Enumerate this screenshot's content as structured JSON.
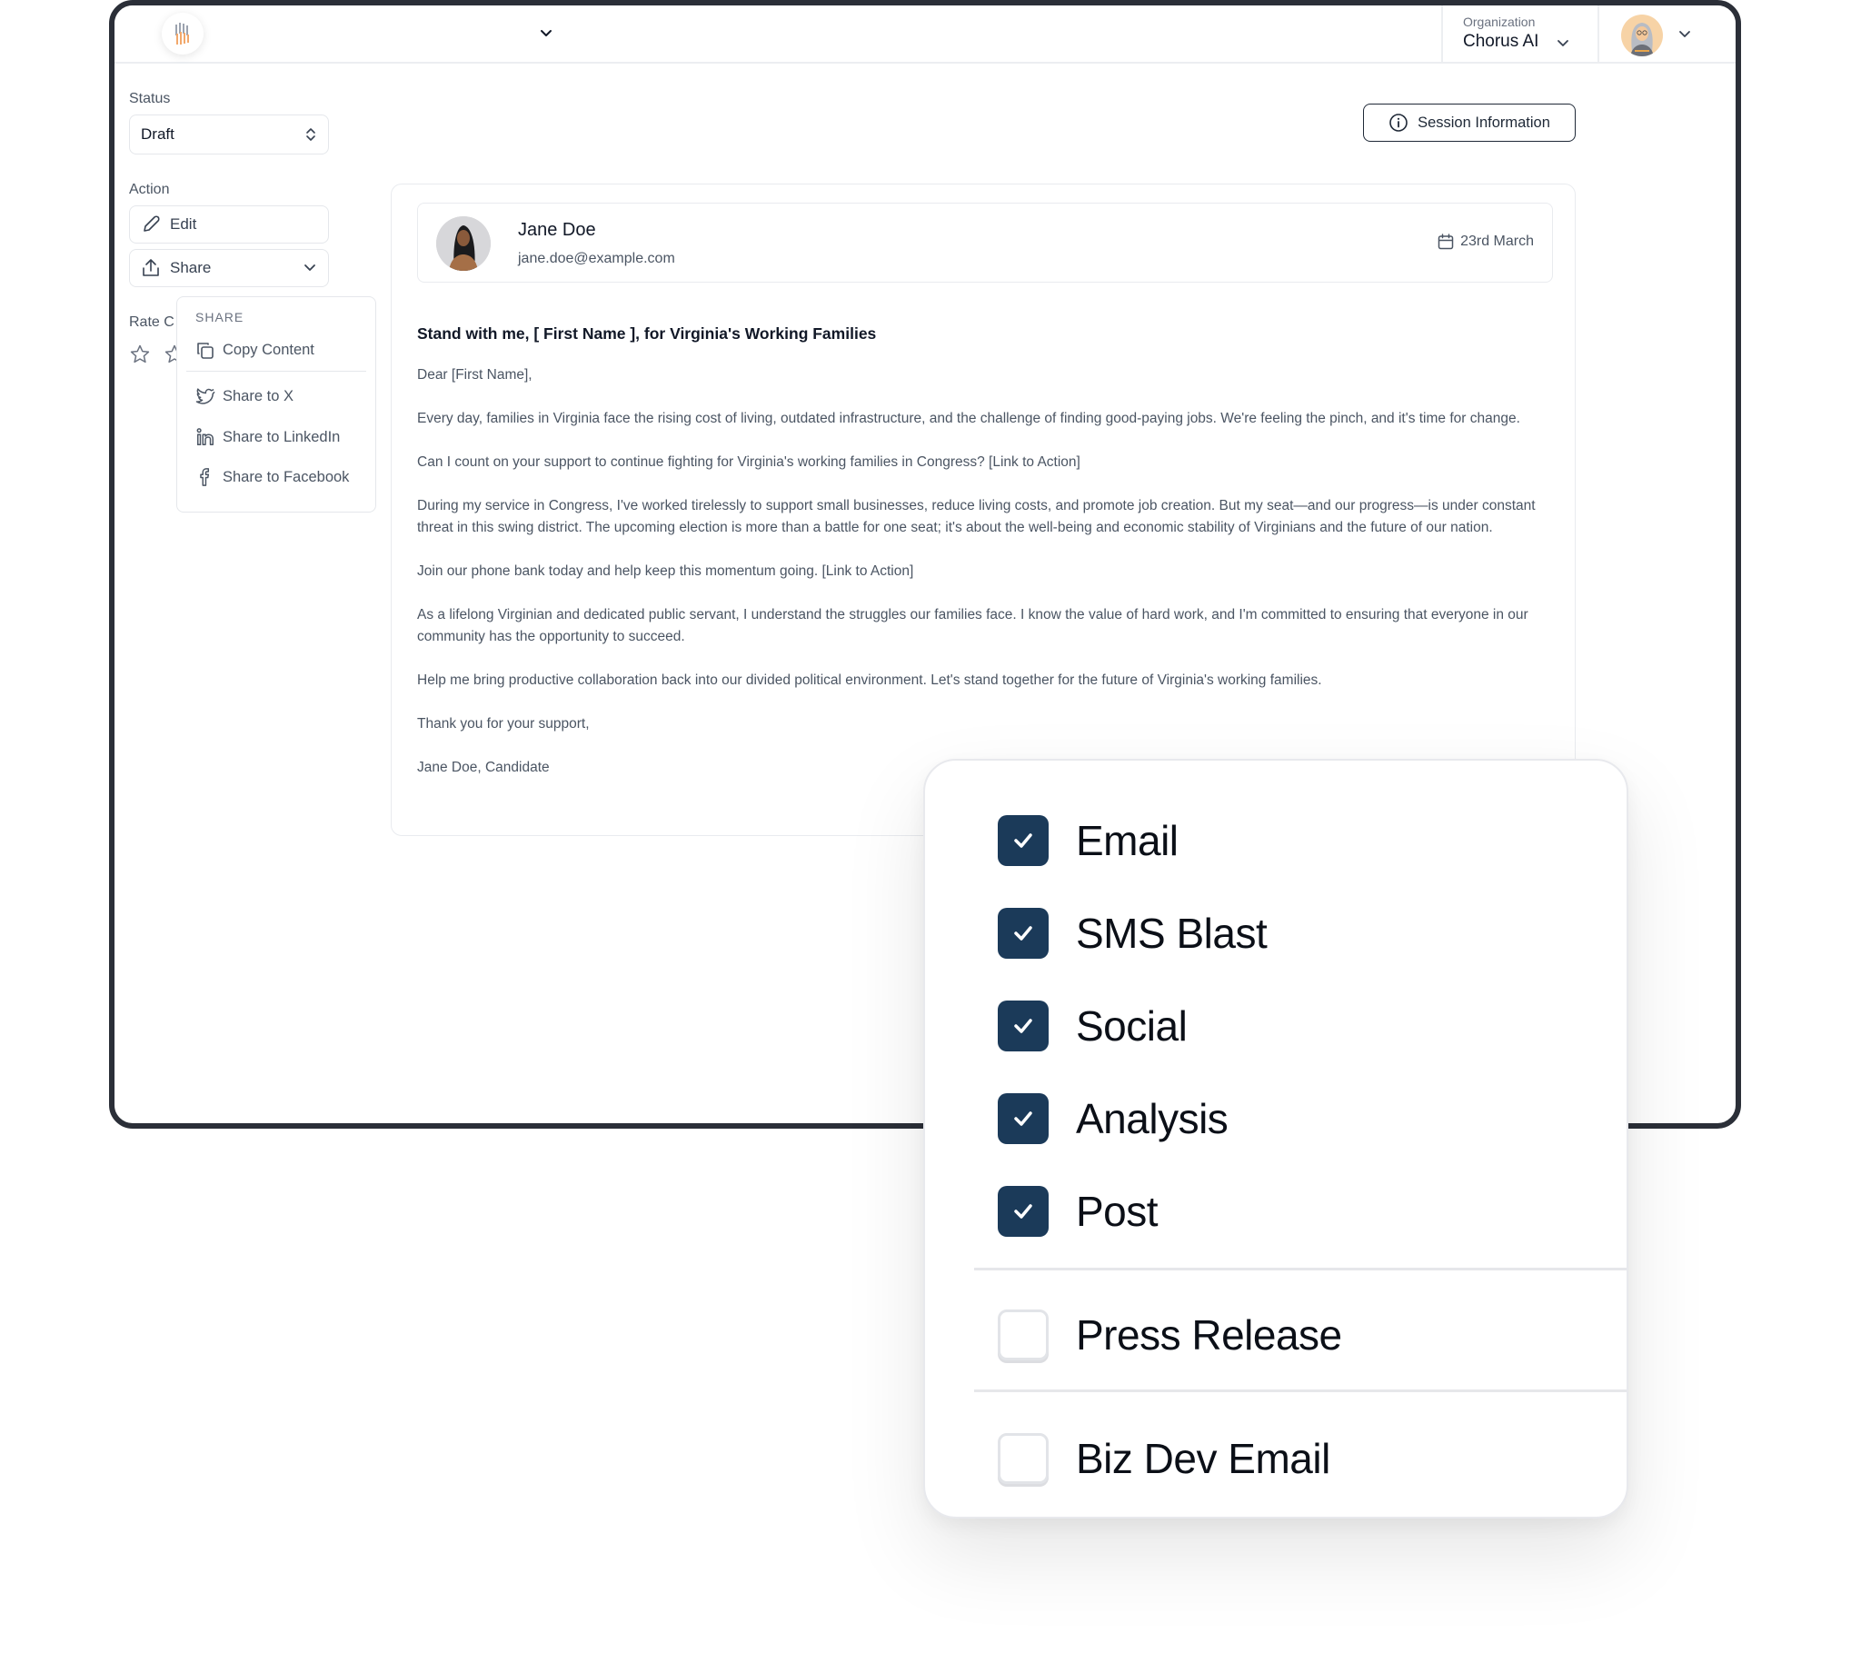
{
  "topbar": {
    "organization_label": "Organization",
    "organization_name": "Chorus AI",
    "icons": [
      "app-logo",
      "chevron-down-icon",
      "user-avatar"
    ]
  },
  "sidebar": {
    "status_label": "Status",
    "status_value": "Draft",
    "action_label": "Action",
    "edit_label": "Edit",
    "share_label": "Share",
    "rate_label": "Rate C",
    "rating": {
      "filled": 0,
      "max": 5
    }
  },
  "share_menu": {
    "title": "SHARE",
    "items": [
      {
        "label": "Copy Content",
        "icon": "copy-icon"
      },
      {
        "label": "Share to X",
        "icon": "twitter-icon"
      },
      {
        "label": "Share to LinkedIn",
        "icon": "linkedin-icon"
      },
      {
        "label": "Share to Facebook",
        "icon": "facebook-icon"
      }
    ]
  },
  "session_button": {
    "label": "Session Information",
    "icon": "info-icon"
  },
  "message": {
    "sender_name": "Jane Doe",
    "sender_email": "jane.doe@example.com",
    "date": "23rd March",
    "subject": "Stand with me, [ First Name ], for Virginia's Working Families",
    "paragraphs": [
      "Dear [First Name],",
      "Every day, families in Virginia face the rising cost of living, outdated infrastructure, and the challenge of finding good-paying jobs. We're feeling the pinch, and it's time for change.",
      "Can I count on your support to continue fighting for Virginia's working families in Congress? [Link to Action]",
      "During my service in Congress, I've worked tirelessly to support small businesses, reduce living costs, and promote job creation. But my seat—and our progress—is under constant threat in this swing district. The upcoming election is more than a battle for one seat; it's about the well-being and economic stability of Virginians and the future of our nation.",
      "Join our phone bank today and help keep this momentum going. [Link to Action]",
      "As a lifelong Virginian and dedicated public servant, I understand the struggles our families face. I know the value of hard work, and I'm committed to ensuring that everyone in our community has the opportunity to succeed.",
      "Help me bring productive collaboration back into our divided political environment. Let's stand together for the future of Virginia's working families.",
      "Thank you for your support,",
      "Jane Doe, Candidate"
    ]
  },
  "channels": {
    "accent_color": "#1b3a59",
    "items": [
      {
        "label": "Email",
        "checked": true
      },
      {
        "label": "SMS Blast",
        "checked": true
      },
      {
        "label": "Social",
        "checked": true
      },
      {
        "label": "Analysis",
        "checked": true
      },
      {
        "label": "Post",
        "checked": true
      },
      {
        "label": "Press Release",
        "checked": false
      },
      {
        "label": "Biz Dev Email",
        "checked": false
      }
    ]
  }
}
